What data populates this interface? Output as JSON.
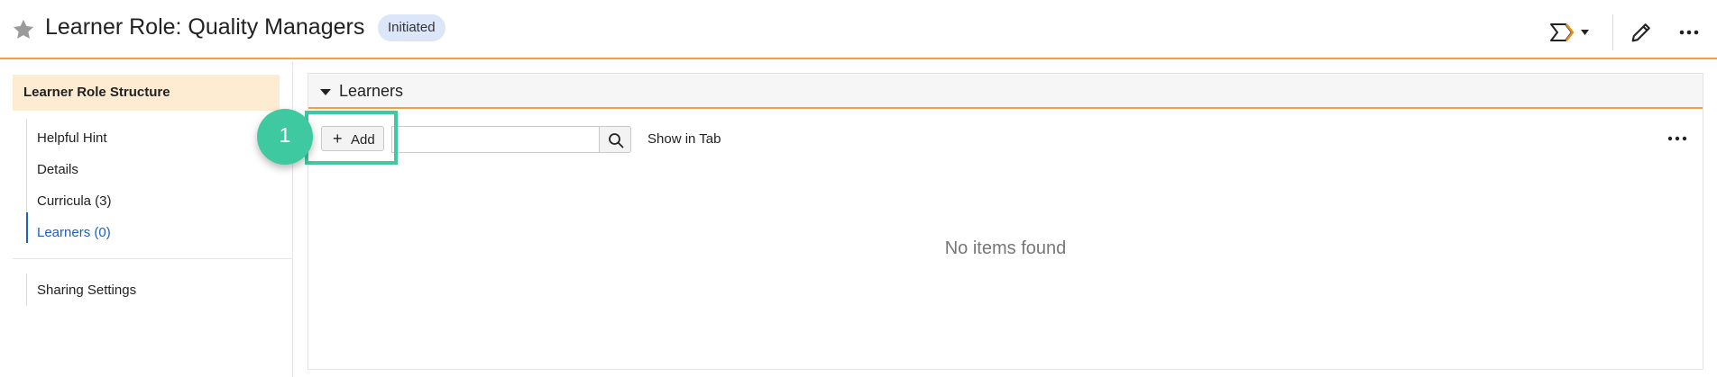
{
  "header": {
    "title": "Learner Role: Quality Managers",
    "status_badge": "Initiated",
    "icons": [
      "star-icon",
      "flow-chevron-icon",
      "caret-down-icon",
      "pencil-icon",
      "more-icon"
    ]
  },
  "sidebar": {
    "title": "Learner Role Structure",
    "items": [
      {
        "label": "Helpful Hint",
        "active": false
      },
      {
        "label": "Details",
        "active": false
      },
      {
        "label": "Curricula (3)",
        "active": false
      },
      {
        "label": "Learners (0)",
        "active": true
      }
    ],
    "bottom_items": [
      {
        "label": "Sharing Settings"
      }
    ]
  },
  "panel": {
    "title": "Learners",
    "add_label": "Add",
    "search": {
      "value": "",
      "placeholder": ""
    },
    "show_in_tab": "Show in Tab",
    "empty_message": "No items found"
  },
  "callout": {
    "number": "1"
  },
  "colors": {
    "accent_orange": "#f0a04b",
    "badge_bg": "#dbe6f9",
    "sidebar_title_bg": "#fdecd2",
    "active_link": "#1f5fbd",
    "callout": "#3ec9a0"
  }
}
